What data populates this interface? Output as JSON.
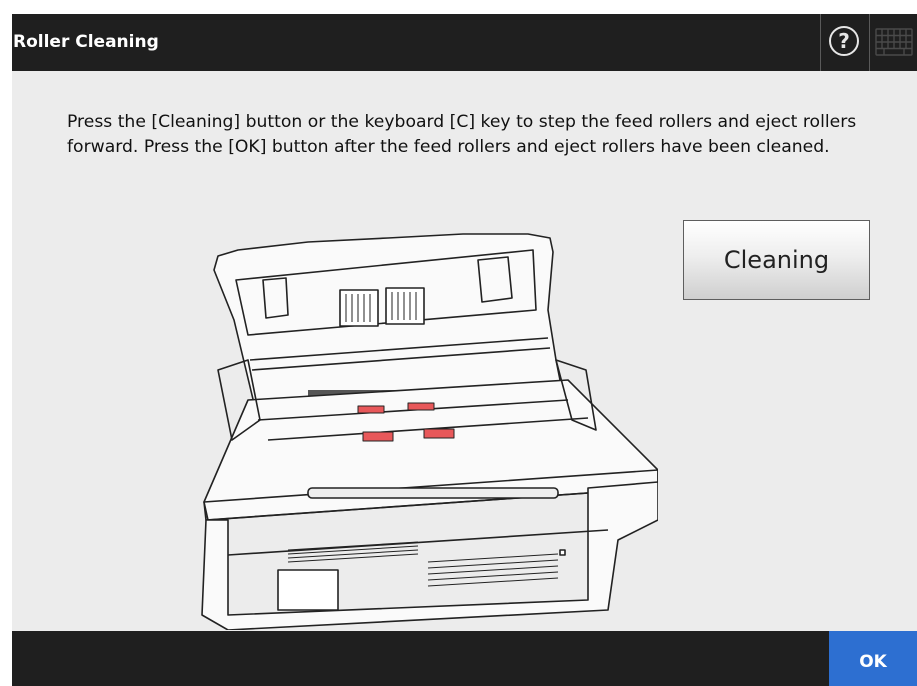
{
  "window": {
    "title": "Roller Cleaning"
  },
  "header": {
    "help_icon": "question-mark-circle-icon",
    "help_glyph": "?",
    "keyboard_icon": "keyboard-icon"
  },
  "main": {
    "instructions": "Press the [Cleaning] button or the keyboard [C] key to step the feed rollers and eject rollers forward. Press the [OK] button after the feed rollers and eject rollers have been cleaned.",
    "cleaning_button_label": "Cleaning",
    "illustration": "scanner-open-rollers-illustration",
    "roller_highlight_color": "#e8585a"
  },
  "footer": {
    "ok_label": "OK",
    "ok_color": "#2d6fd1"
  }
}
